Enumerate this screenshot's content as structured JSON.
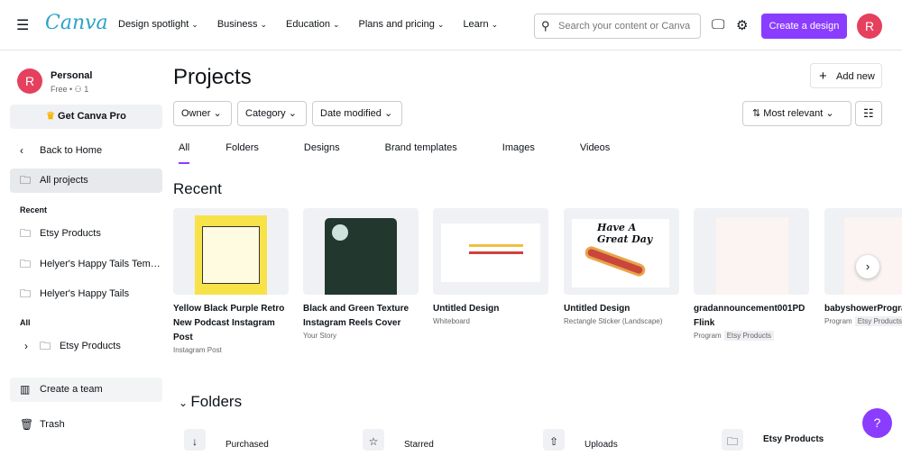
{
  "header": {
    "logo": "Canva",
    "nav": [
      "Design spotlight",
      "Business",
      "Education",
      "Plans and pricing",
      "Learn"
    ],
    "search_placeholder": "Search your content or Canva",
    "create": "Create a design",
    "avatar": "R"
  },
  "sidebar": {
    "account_name": "Personal",
    "account_plan": "Free • ⚇ 1",
    "avatar": "R",
    "pro": "Get Canva Pro",
    "back": "Back to Home",
    "all_projects": "All projects",
    "recent_label": "Recent",
    "recent": [
      "Etsy Products",
      "Helyer's Happy Tails Tem…",
      "Helyer's Happy Tails"
    ],
    "all_label": "All",
    "all": [
      "Etsy Products"
    ],
    "create_team": "Create a team",
    "trash": "Trash"
  },
  "main": {
    "title": "Projects",
    "add_new": "Add new",
    "filters": [
      "Owner",
      "Category",
      "Date modified"
    ],
    "sort": "Most relevant",
    "tabs": [
      "All",
      "Folders",
      "Designs",
      "Brand templates",
      "Images",
      "Videos"
    ],
    "recent_title": "Recent",
    "cards": [
      {
        "title": "Yellow Black Purple Retro New Podcast Instagram Post",
        "sub": "Instagram Post",
        "tag": ""
      },
      {
        "title": "Black and Green Texture Instagram Reels Cover",
        "sub": "Your Story",
        "tag": ""
      },
      {
        "title": "Untitled Design",
        "sub": "Whiteboard",
        "tag": ""
      },
      {
        "title": "Untitled Design",
        "sub": "Rectangle Sticker (Landscape)",
        "tag": "",
        "thumb_text": "Have A Great Day"
      },
      {
        "title": "gradannouncement001PDFlink",
        "sub": "Program",
        "tag": "Etsy Products"
      },
      {
        "title": "babyshowerProgram",
        "sub": "Program",
        "tag": "Etsy Products"
      }
    ],
    "folders_title": "Folders",
    "folders": [
      "Purchased",
      "Starred",
      "Uploads",
      "Etsy Products"
    ]
  },
  "help": "?"
}
